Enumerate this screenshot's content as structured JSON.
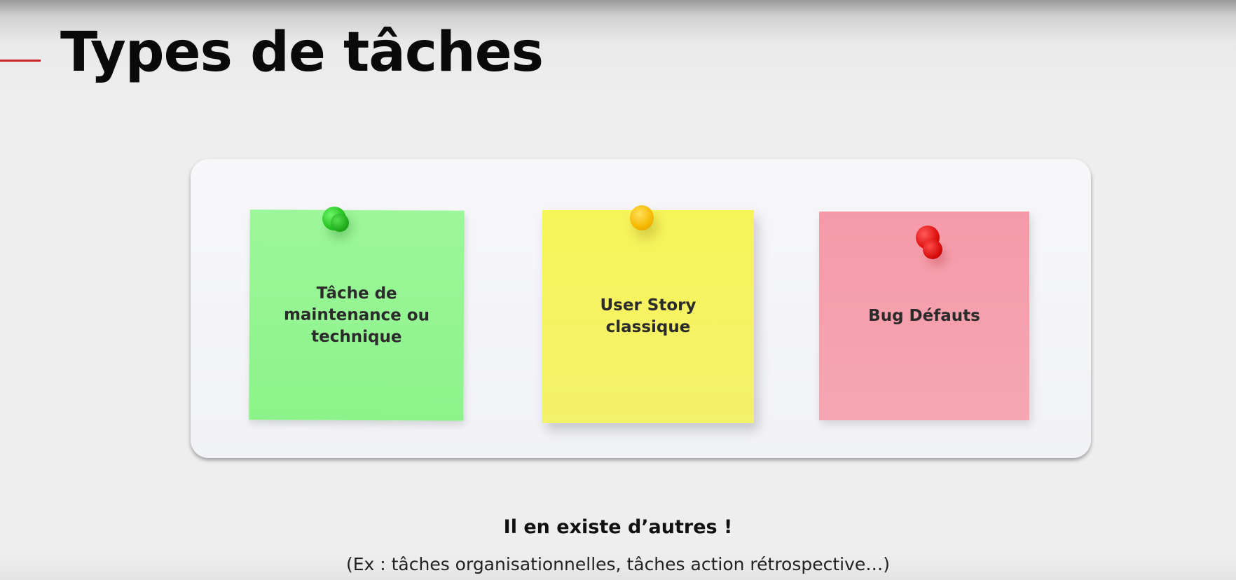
{
  "slide": {
    "title": "Types de tâches"
  },
  "notes": [
    {
      "lines": [
        "Tâche de",
        "maintenance ou",
        "technique"
      ],
      "color": "#95f593",
      "pin_color": "#23c21f"
    },
    {
      "lines": [
        "User Story",
        "classique"
      ],
      "color": "#f5f263",
      "pin_color": "#f5b800"
    },
    {
      "lines": [
        "Bug Défauts"
      ],
      "color": "#f6a0ad",
      "pin_color": "#e01010"
    }
  ],
  "footer": {
    "main": "Il en existe d’autres !",
    "sub": "(Ex : tâches organisationnelles, tâches action rétrospective…)"
  },
  "colors": {
    "accent": "#d0202a"
  }
}
